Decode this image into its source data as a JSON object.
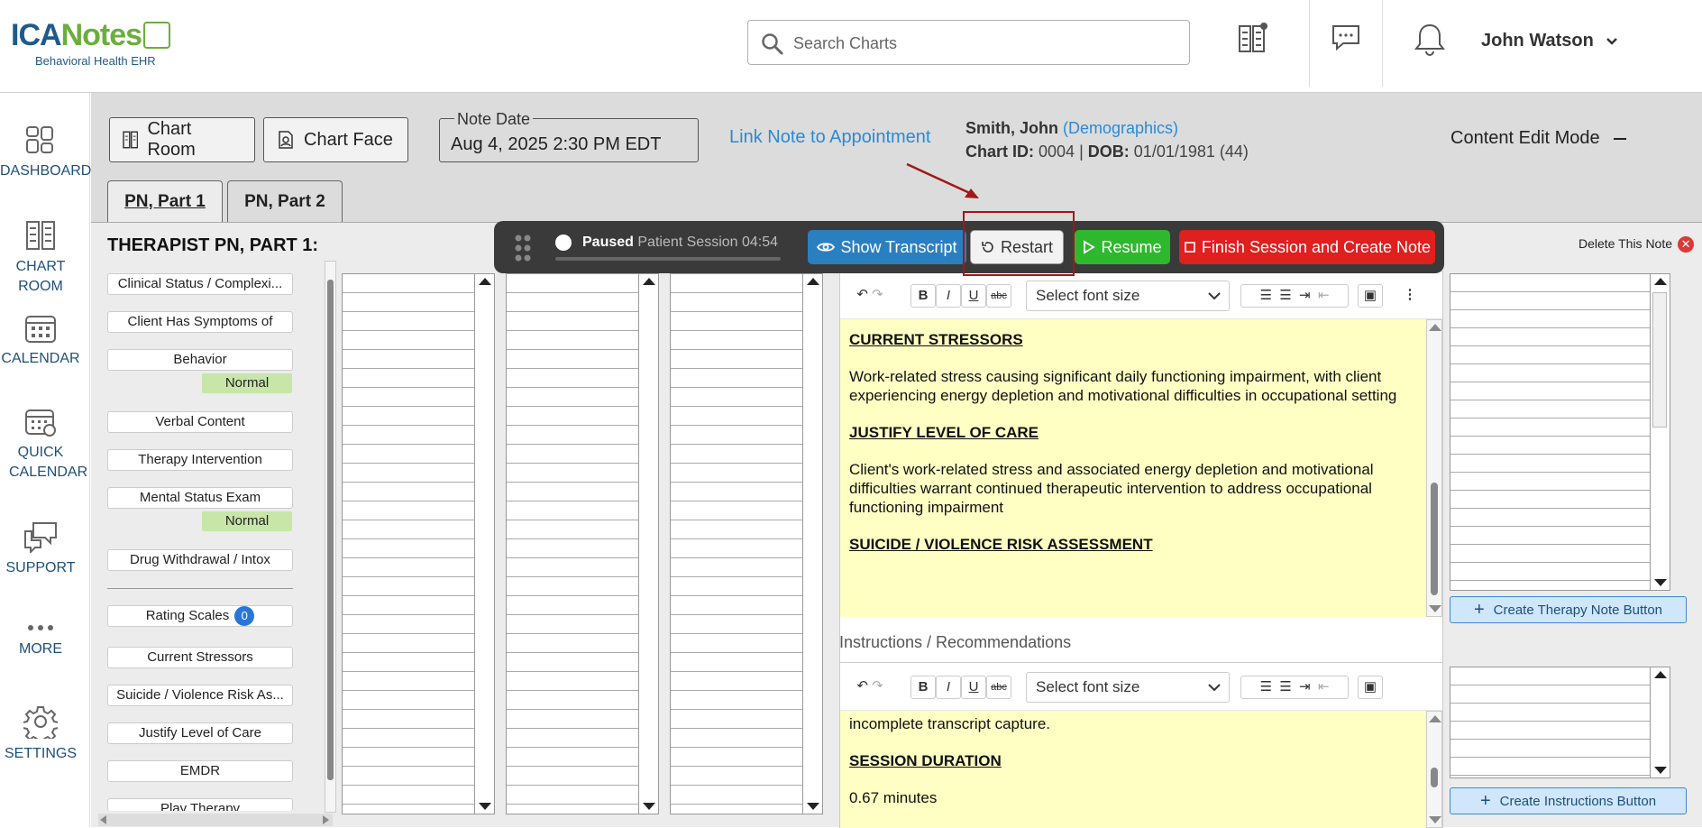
{
  "header": {
    "logo_main": "ICANotes",
    "logo_sub": "Behavioral Health EHR",
    "search_placeholder": "Search Charts",
    "user_name": "John Watson"
  },
  "sidebar": {
    "items": [
      {
        "label": "DASHBOARD",
        "icon": "dashboard-icon"
      },
      {
        "label": "CHART ROOM",
        "icon": "chart-room-icon"
      },
      {
        "label": "CALENDAR",
        "icon": "calendar-icon"
      },
      {
        "label": "QUICK CALENDAR",
        "icon": "quick-calendar-icon"
      },
      {
        "label": "SUPPORT",
        "icon": "support-icon"
      },
      {
        "label": "MORE",
        "icon": "more-icon"
      },
      {
        "label": "SETTINGS",
        "icon": "gear-icon"
      }
    ]
  },
  "toolbar": {
    "chart_room": "Chart Room",
    "chart_face": "Chart Face",
    "note_date_label": "Note Date",
    "note_date_value": "Aug 4, 2025 2:30 PM EDT",
    "link_appt": "Link Note to Appointment",
    "content_edit_mode": "Content Edit Mode"
  },
  "patient": {
    "name": "Smith, John",
    "demographics": "(Demographics)",
    "chart_id_label": "Chart ID:",
    "chart_id": "0004",
    "sep": "|",
    "dob_label": "DOB:",
    "dob": "01/01/1981 (44)"
  },
  "tabs": [
    "PN, Part 1",
    "PN, Part 2"
  ],
  "section_title": "THERAPIST PN, PART 1:",
  "left_items": [
    {
      "label": "Clinical Status / Complexi..."
    },
    {
      "label": "Client Has Symptoms of"
    },
    {
      "label": "Behavior",
      "badge": "Normal"
    },
    {
      "label": "Verbal Content"
    },
    {
      "label": "Therapy Intervention"
    },
    {
      "label": "Mental Status Exam",
      "badge": "Normal"
    },
    {
      "label": "Drug Withdrawal / Intox"
    },
    {
      "label": "Rating Scales",
      "count": "0"
    },
    {
      "label": "Current Stressors"
    },
    {
      "label": "Suicide / Violence Risk As..."
    },
    {
      "label": "Justify Level of Care"
    },
    {
      "label": "EMDR"
    },
    {
      "label": "Play Therapy"
    }
  ],
  "recorder": {
    "status": "Paused",
    "session": "Patient Session 04:54",
    "show_transcript": "Show Transcript",
    "restart": "Restart",
    "resume": "Resume",
    "finish": "Finish Session and Create Note",
    "progress": 0
  },
  "delete_note": "Delete This Note",
  "editor": {
    "font_size_placeholder": "Select font size",
    "heading1": "CURRENT STRESSORS",
    "para1": "Work-related stress causing significant daily functioning impairment, with client experiencing energy depletion and motivational difficulties in occupational setting",
    "heading2": "JUSTIFY LEVEL OF CARE",
    "para2": "Client's work-related stress and associated energy depletion and motivational difficulties warrant continued therapeutic intervention to address occupational functioning impairment",
    "heading3": "SUICIDE / VIOLENCE RISK ASSESSMENT"
  },
  "instructions": {
    "label": "Instructions / Recommendations",
    "line1": "incomplete transcript capture.",
    "heading": "SESSION DURATION",
    "line2": "0.67 minutes"
  },
  "create_therapy_btn": "Create Therapy Note Button",
  "create_instr_btn": "Create Instructions Button",
  "colors": {
    "brand_blue": "#1e5a8c",
    "link_blue": "#2a8ad8",
    "resume_green": "#2eb82e",
    "finish_red": "#e01f1f",
    "transcript_blue": "#2a7fc1",
    "highlight_yellow": "#ffffc4"
  }
}
